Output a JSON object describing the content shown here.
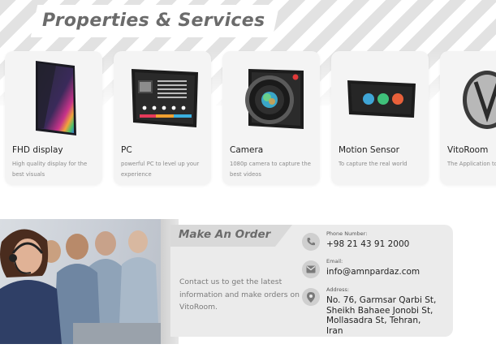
{
  "properties": {
    "title": "Properties & Services",
    "cards": [
      {
        "name": "FHD display",
        "desc": "High quality display for the best visuals",
        "icon": "fhd-display-icon"
      },
      {
        "name": "PC",
        "desc": "powerful PC to level up your experience",
        "icon": "pc-board-icon"
      },
      {
        "name": "Camera",
        "desc": "1080p camera to capture the best videos",
        "icon": "camera-icon"
      },
      {
        "name": "Motion Sensor",
        "desc": "To capture the real world",
        "icon": "motion-sensor-icon"
      },
      {
        "name": "VitoRoom",
        "desc": "The Application to run it all",
        "icon": "vitoroom-logo-icon"
      }
    ]
  },
  "order": {
    "title": "Make An Order",
    "description": "Contact us to get the latest information and make orders on VitoRoom.",
    "phone_label": "Phone Number:",
    "phone": "+98 21 43 91 2000",
    "email_label": "Email:",
    "email": "info@amnpardaz.com",
    "address_label": "Address:",
    "address": "No. 76, Garmsar Qarbi St, Sheikh Bahaee Jonobi St, Mollasadra St, Tehran, Iran"
  },
  "colors": {
    "accent_gray": "#6b6b6b",
    "card_bg": "#f4f4f4",
    "order_bg": "#ebebeb"
  }
}
